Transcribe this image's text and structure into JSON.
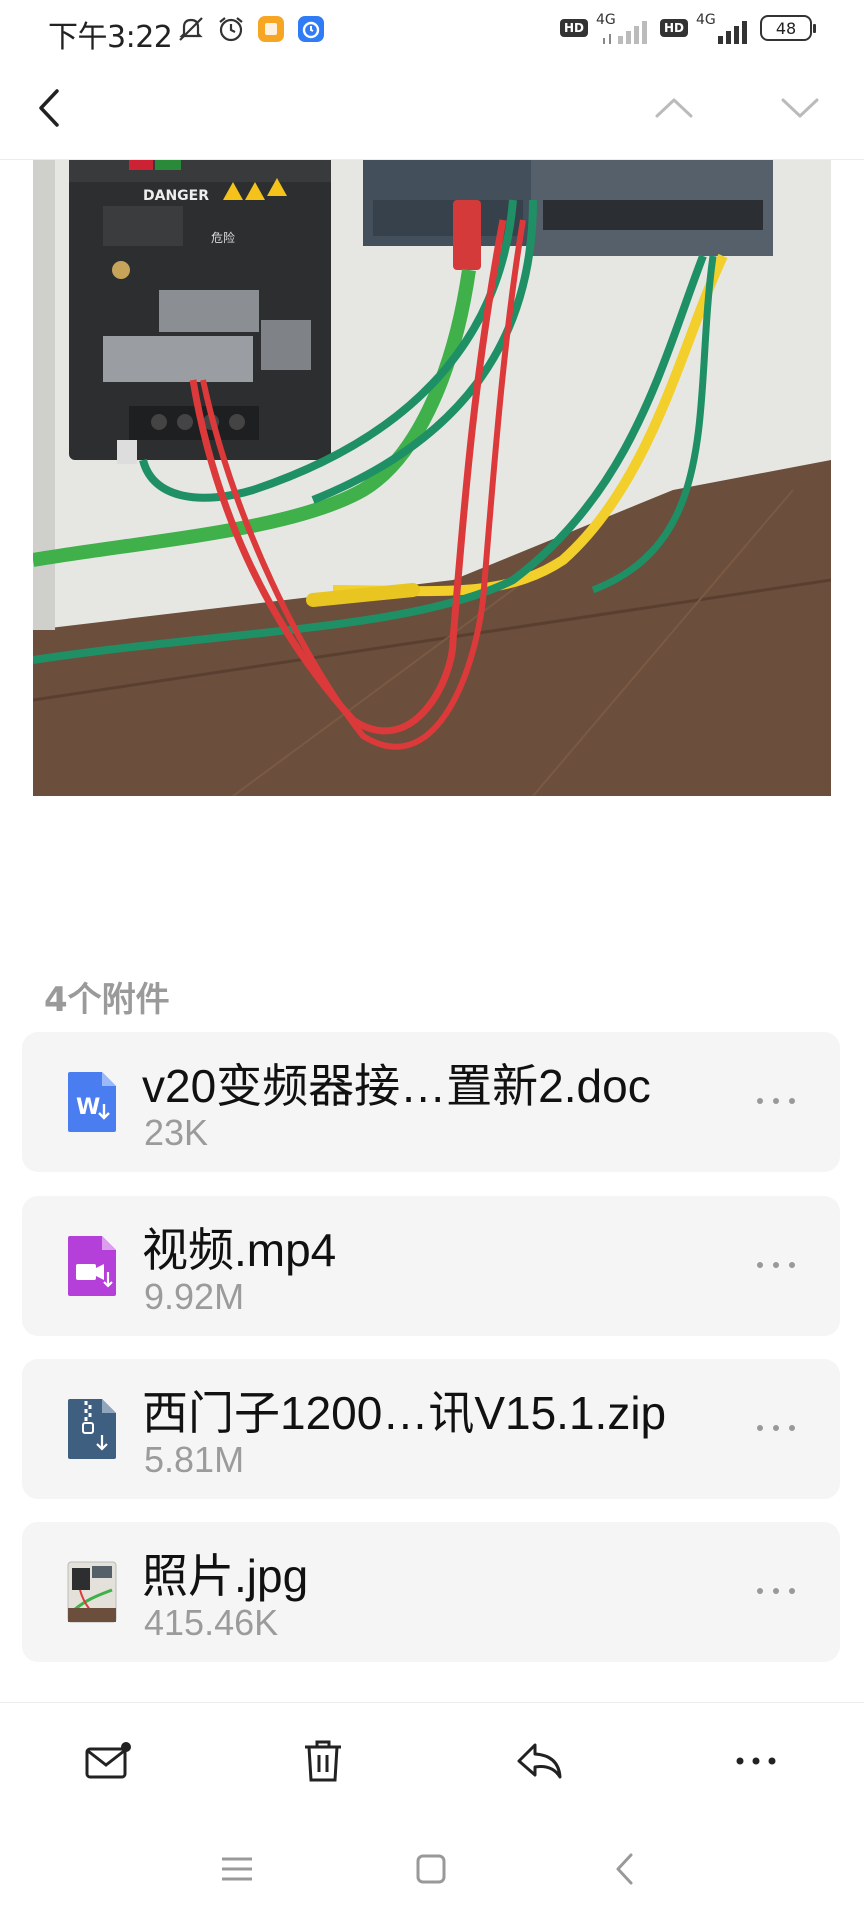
{
  "status_bar": {
    "time": "下午3:22",
    "network_1": "4G",
    "network_2": "4G",
    "hd_label": "HD",
    "battery": "48"
  },
  "top_nav": {
    "back_icon": "chevron-left-icon",
    "prev_icon": "chevron-up-icon",
    "next_icon": "chevron-down-icon"
  },
  "photo": {
    "danger_label": "DANGER",
    "danger_cn": "危险"
  },
  "attachments": {
    "title": "4个附件",
    "items": [
      {
        "name": "v20变频器接…置新2.doc",
        "size": "23K",
        "icon": "word-file-icon",
        "color": "#4a7df0"
      },
      {
        "name": "视频.mp4",
        "size": "9.92M",
        "icon": "video-file-icon",
        "color": "#b43fd9"
      },
      {
        "name": "西门子1200…讯V15.1.zip",
        "size": "5.81M",
        "icon": "zip-file-icon",
        "color": "#3f5f80"
      },
      {
        "name": "照片.jpg",
        "size": "415.46K",
        "icon": "image-file-icon",
        "color": "#888888"
      }
    ]
  },
  "toolbar": {
    "items": [
      "mail-icon",
      "trash-icon",
      "reply-icon",
      "more-icon"
    ]
  }
}
